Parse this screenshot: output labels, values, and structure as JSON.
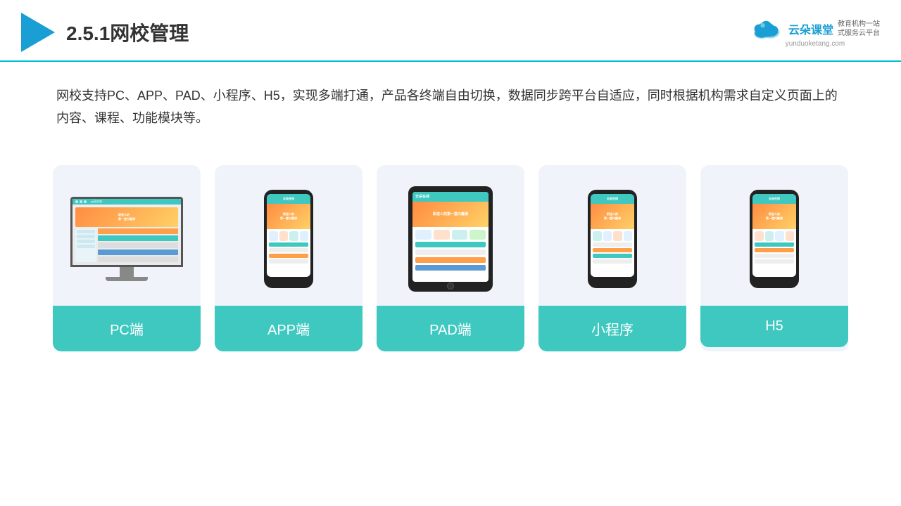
{
  "header": {
    "title": "2.5.1网校管理",
    "brand_cn": "云朵课堂",
    "brand_url": "yunduoketang.com",
    "brand_slogan_line1": "教育机构一站",
    "brand_slogan_line2": "式服务云平台"
  },
  "description": {
    "text": "网校支持PC、APP、PAD、小程序、H5，实现多端打通，产品各终端自由切换，数据同步跨平台自适应，同时根据机构需求自定义页面上的内容、课程、功能模块等。"
  },
  "cards": [
    {
      "id": "pc",
      "label": "PC端"
    },
    {
      "id": "app",
      "label": "APP端"
    },
    {
      "id": "pad",
      "label": "PAD端"
    },
    {
      "id": "miniprogram",
      "label": "小程序"
    },
    {
      "id": "h5",
      "label": "H5"
    }
  ]
}
